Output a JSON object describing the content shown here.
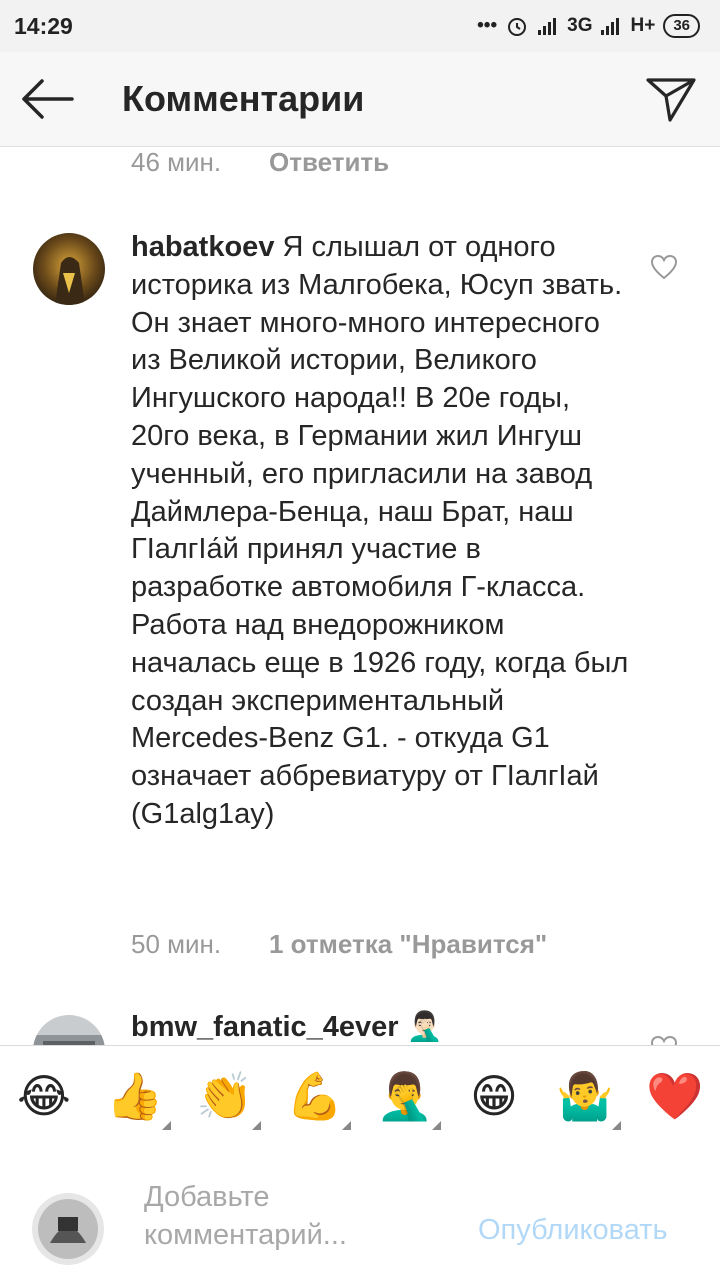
{
  "status_bar": {
    "time": "14:29",
    "dots": "•••",
    "network_3g": "3G",
    "network_hplus": "H+",
    "battery": "36"
  },
  "header": {
    "title": "Комментарии",
    "back_icon": "arrow-left-icon",
    "send_icon": "paper-plane-icon"
  },
  "previous_comment": {
    "time": "46 мин.",
    "reply_label": "Ответить"
  },
  "comments": [
    {
      "username": "habatkoev",
      "text": "Я слышал от одного историка из Малгобека, Юсуп звать. Он знает много-много интересного из Великой истории, Великого Ингушского народа!! В 20е годы, 20го века, в Германии жил Ингуш ученный, его пригласили на завод Даймлера-Бенца, наш Брат, наш ГӀалгӀа́й принял участие в разработке автомобиля Г-класса. Работа над внедорожником началась еще в 1926 году, когда был создан экспериментальный Mercedes-Benz G1. - откуда G1 означает аббревиатуру от ГӀалгӀай (G1alg1ay)",
      "time": "50 мин.",
      "likes": "1 отметка \"Нравится\""
    },
    {
      "username": "bmw_fanatic_4ever",
      "username_emoji": "🤦🏻‍♂️"
    }
  ],
  "emoji_bar": [
    "😂",
    "👍",
    "👏",
    "💪",
    "🤦‍♂️",
    "😁",
    "🤷‍♂️",
    "❤️"
  ],
  "composer": {
    "placeholder": "Добавьте комментарий...",
    "publish_label": "Опубликовать"
  },
  "colors": {
    "text": "#262626",
    "muted": "#999999",
    "publish_disabled": "#b2d8f8",
    "heart": "#ed4956"
  }
}
